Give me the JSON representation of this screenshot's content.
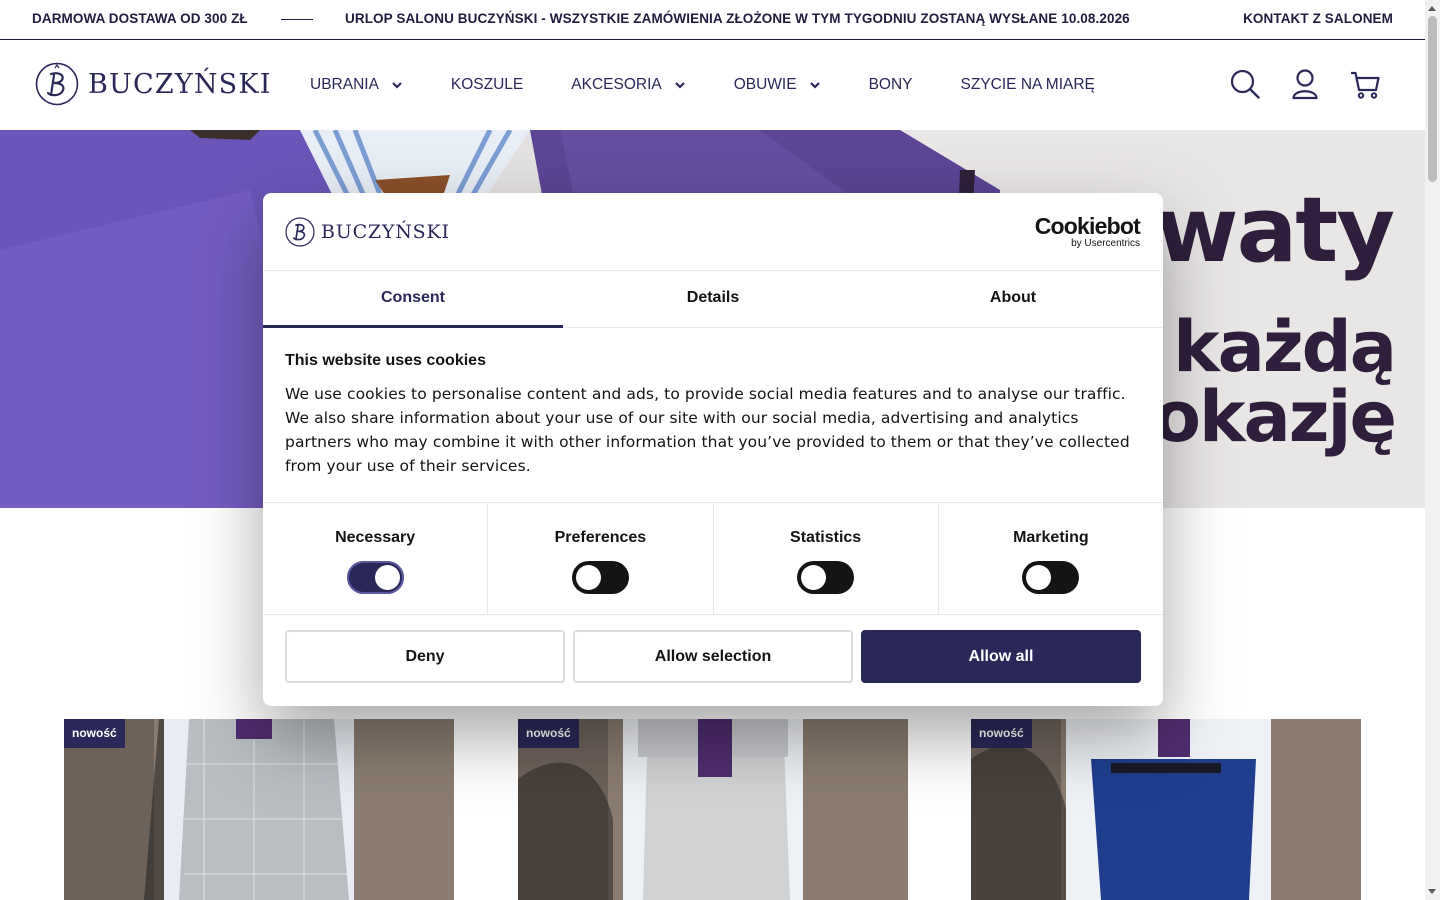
{
  "topbar": {
    "shipping": "DARMOWA DOSTAWA OD 300 ZŁ",
    "notice": "URLOP SALONU BUCZYŃSKI - WSZYSTKIE ZAMÓWIENIA ZŁOŻONE W TYM TYGODNIU ZOSTANĄ WYSŁANE 10.08.2026",
    "contact": "KONTAKT Z SALONEM"
  },
  "brand": {
    "name": "BUCZYŃSKI",
    "color": "#2a2858"
  },
  "nav": {
    "items": [
      {
        "label": "UBRANIA",
        "has_dropdown": true
      },
      {
        "label": "KOSZULE",
        "has_dropdown": false
      },
      {
        "label": "AKCESORIA",
        "has_dropdown": true
      },
      {
        "label": "OBUWIE",
        "has_dropdown": true
      },
      {
        "label": "BONY",
        "has_dropdown": false
      },
      {
        "label": "SZYCIE NA MIARĘ",
        "has_dropdown": false
      }
    ],
    "icons": [
      "search-icon",
      "user-icon",
      "cart-icon"
    ]
  },
  "hero": {
    "line1": "waty",
    "line2": "a każdą",
    "line3": "okazję"
  },
  "products": [
    {
      "badge": "nowość",
      "trouser_color": "#b7bcc1"
    },
    {
      "badge": "nowość",
      "trouser_color": "#cfd1d3"
    },
    {
      "badge": "nowość",
      "trouser_color": "#1f3e8e"
    }
  ],
  "cookie_dialog": {
    "provider_main": "Cookiebot",
    "provider_sub": "by Usercentrics",
    "tabs": [
      {
        "label": "Consent",
        "active": true
      },
      {
        "label": "Details",
        "active": false
      },
      {
        "label": "About",
        "active": false
      }
    ],
    "heading": "This website uses cookies",
    "body": "We use cookies to personalise content and ads, to provide social media features and to analyse our traffic. We also share information about your use of our site with our social media, advertising and analytics partners who may combine it with other information that you’ve provided to them or that they’ve collected from your use of their services.",
    "categories": [
      {
        "label": "Necessary",
        "enabled": true
      },
      {
        "label": "Preferences",
        "enabled": false
      },
      {
        "label": "Statistics",
        "enabled": false
      },
      {
        "label": "Marketing",
        "enabled": false
      }
    ],
    "buttons": {
      "deny": "Deny",
      "allow_selection": "Allow selection",
      "allow_all": "Allow all"
    },
    "accent": "#2a2858"
  }
}
